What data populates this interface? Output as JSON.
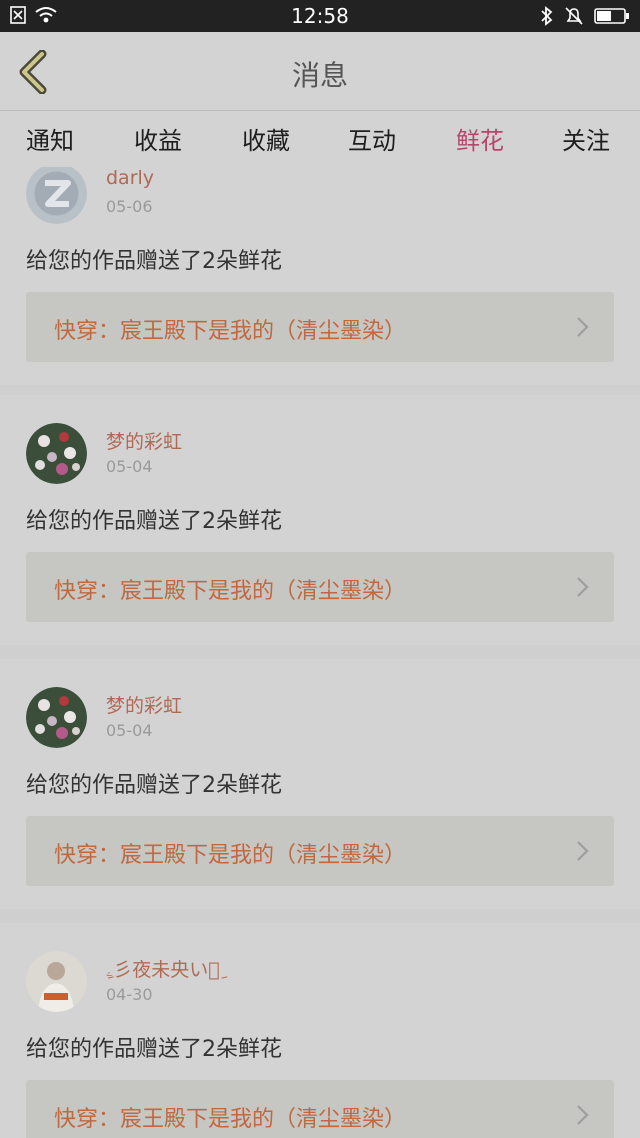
{
  "status_bar": {
    "time": "12:58"
  },
  "header": {
    "title": "消息"
  },
  "tabs": [
    {
      "label": "通知",
      "active": false
    },
    {
      "label": "收益",
      "active": false
    },
    {
      "label": "收藏",
      "active": false
    },
    {
      "label": "互动",
      "active": false
    },
    {
      "label": "鲜花",
      "active": true
    },
    {
      "label": "关注",
      "active": false
    }
  ],
  "feed": {
    "items": [
      {
        "username": "darly",
        "date": "05-06",
        "message": "给您的作品赠送了2朵鲜花",
        "work_title": "快穿：宸王殿下是我的（清尘墨染）",
        "avatar_icon": "qq-avatar-icon"
      },
      {
        "username": "梦的彩虹",
        "date": "05-04",
        "message": "给您的作品赠送了2朵鲜花",
        "work_title": "快穿：宸王殿下是我的（清尘墨染）",
        "avatar_icon": "flowers-avatar"
      },
      {
        "username": "梦的彩虹",
        "date": "05-04",
        "message": "给您的作品赠送了2朵鲜花",
        "work_title": "快穿：宸王殿下是我的（清尘墨染）",
        "avatar_icon": "flowers-avatar"
      },
      {
        "username": "ِۦ彡夜未央い৲ِ",
        "date": "04-30",
        "message": "给您的作品赠送了2朵鲜花",
        "work_title": "快穿：宸王殿下是我的（清尘墨染）",
        "avatar_icon": "photo-avatar"
      }
    ]
  },
  "colors": {
    "accent": "#b5476b",
    "username": "#b06a54",
    "work_title": "#c0683f"
  }
}
